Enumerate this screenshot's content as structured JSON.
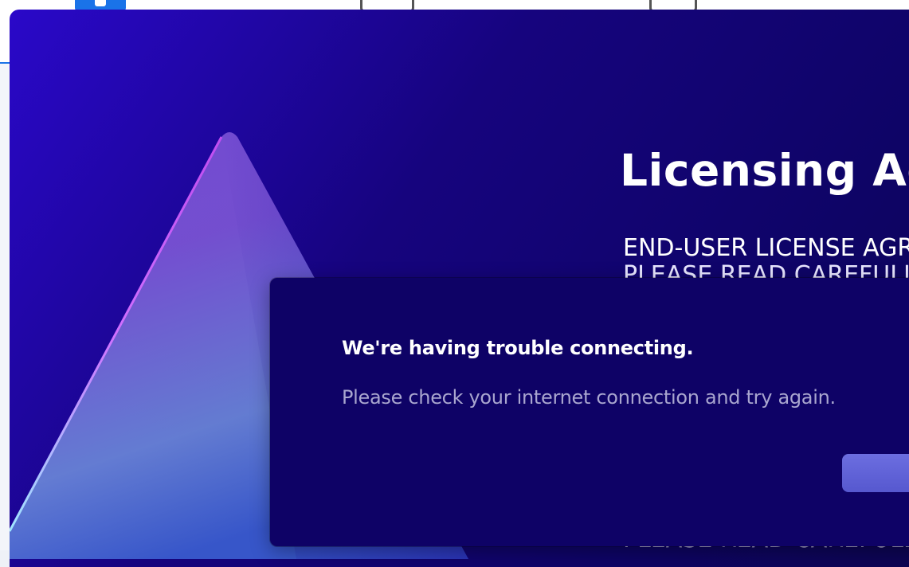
{
  "license": {
    "title": "Licensing Ag",
    "eula_line1": "END-USER LICENSE AGR",
    "eula_line2": "PLEASE READ CAREFULLY"
  },
  "error": {
    "heading": "We're having trouble connecting.",
    "message": "Please check your internet connection and try again.",
    "button_label": ""
  },
  "colors": {
    "window_background": "#16047e",
    "dialog_background": "#0e0266",
    "button_background": "#6163d8",
    "message_text": "#a9a6cf"
  },
  "icons": [
    "person-icon",
    "app-icon",
    "profile-icon",
    "triangle-logo"
  ]
}
